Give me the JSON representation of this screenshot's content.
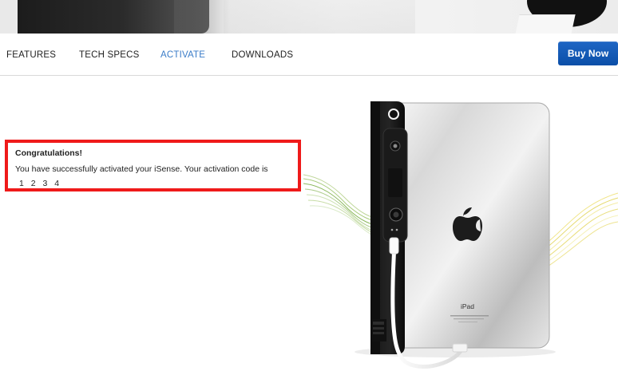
{
  "nav": {
    "items": [
      {
        "label": "FEATURES"
      },
      {
        "label": "TECH SPECS"
      },
      {
        "label": "ACTIVATE"
      },
      {
        "label": "DOWNLOADS"
      }
    ],
    "buy_label": "Buy Now"
  },
  "message": {
    "title": "Congratulations!",
    "text": "You have successfully activated your iSense. Your activation code is",
    "code": "1 2 3 4"
  },
  "device": {
    "label": "iPad"
  },
  "colors": {
    "accent": "#3a7cc8",
    "buy_button": "#0b4fa8",
    "highlight_border": "#ef1a1a"
  },
  "icons": {
    "device_logo": "apple-icon",
    "scanner_lens": "camera-lens-icon"
  }
}
